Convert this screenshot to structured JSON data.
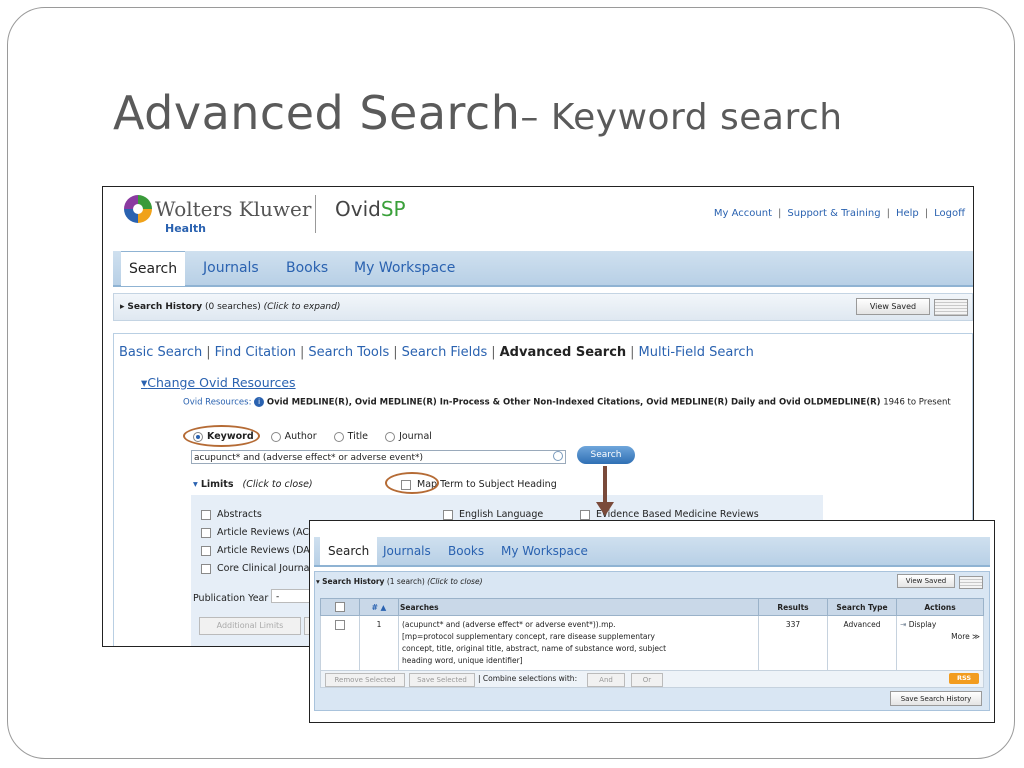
{
  "slide": {
    "title_main": "Advanced Search",
    "title_sub": "– Keyword search"
  },
  "shot1": {
    "brand": "Wolters Kluwer",
    "brand_sub": "Health",
    "product_prefix": "Ovid",
    "product_suffix": "SP",
    "top_links": [
      "My Account",
      "Support & Training",
      "Help",
      "Logoff"
    ],
    "tabs": [
      "Search",
      "Journals",
      "Books",
      "My Workspace"
    ],
    "history": {
      "label": "Search History",
      "count": "(0 searches)",
      "hint": "(Click to expand)",
      "view_saved": "View Saved"
    },
    "sub_tabs": [
      "Basic Search",
      "Find Citation",
      "Search Tools",
      "Search Fields",
      "Advanced Search",
      "Multi-Field Search"
    ],
    "change_resources": "Change Ovid Resources",
    "resources_label": "Ovid Resources:",
    "resources_value": "Ovid MEDLINE(R), Ovid MEDLINE(R) In-Process & Other Non-Indexed Citations, Ovid MEDLINE(R) Daily and Ovid OLDMEDLINE(R)",
    "resources_years": "1946 to Present",
    "radio_options": [
      "Keyword",
      "Author",
      "Title",
      "Journal"
    ],
    "search_value": "acupunct* and (adverse effect* or adverse event*)",
    "search_button": "Search",
    "limits_label": "Limits",
    "limits_hint": "(Click to close)",
    "map_term": "Map Term to Subject Heading",
    "limits_left": [
      "Abstracts",
      "Article Reviews (ACP",
      "Article Reviews (DAR",
      "Core Clinical Journal"
    ],
    "limit_english": "English Language",
    "limit_ebm": "Evidence Based Medicine Reviews",
    "pub_year_label": "Publication Year",
    "pub_year_value": "-",
    "additional_limits": "Additional Limits"
  },
  "shot2": {
    "tabs": [
      "Search",
      "Journals",
      "Books",
      "My Workspace"
    ],
    "history": {
      "label": "Search History",
      "count": "(1 search)",
      "hint": "(Click to close)",
      "view_saved": "View Saved"
    },
    "columns": [
      "",
      "# ▲",
      "Searches",
      "Results",
      "Search Type",
      "Actions"
    ],
    "row": {
      "num": "1",
      "search": "(acupunct* and (adverse effect* or adverse event*)).mp. [mp=protocol supplementary concept, rare disease supplementary concept, title, original title, abstract, name of substance word, subject heading word, unique identifier]",
      "results": "337",
      "type": "Advanced",
      "display": "Display",
      "more": "More ≫"
    },
    "remove_selected": "Remove Selected",
    "save_selected": "Save Selected",
    "combine_label": "Combine selections with:",
    "and": "And",
    "or": "Or",
    "rss": "RSS",
    "save_history": "Save Search History"
  }
}
